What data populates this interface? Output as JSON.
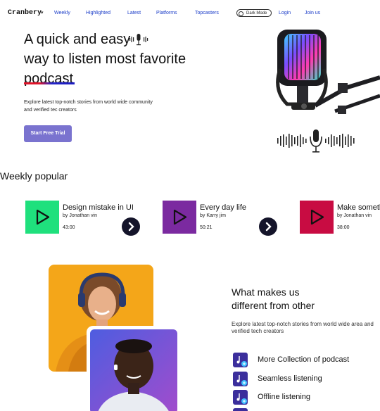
{
  "nav": {
    "brand": "Cranbery",
    "links": [
      "Weekly",
      "Highlighted",
      "Latest",
      "Platforms",
      "Topcasters"
    ],
    "dark_mode_label": "Dark Mode",
    "login": "Login",
    "join": "Join us"
  },
  "hero": {
    "title_line1": "A quick and easy",
    "title_line2": "way to listen most favorite",
    "title_line3": "podcast",
    "description": "Explore latest top-notch stories from world wide community and verified tec creators",
    "cta": "Start Free Trial"
  },
  "weekly": {
    "title": "Weekly popular",
    "cards": [
      {
        "title": "Design mistake in UI",
        "author": "by Jonathan vin",
        "duration": "43:00",
        "color": "#1fe07d"
      },
      {
        "title": "Every day life",
        "author": "by Karry jim",
        "duration": "50:21",
        "color": "#7b2aa0"
      },
      {
        "title": "Make something",
        "author": "by Jonathan vin",
        "duration": "38:00",
        "color": "#c80c42"
      }
    ]
  },
  "features": {
    "title_line1": "What makes us",
    "title_line2": "different from other",
    "description": "Explore latest top-notch stories from world wide area and verified tech creators",
    "items": [
      {
        "label": "More Collection of podcast",
        "icon": "music-note-icon"
      },
      {
        "label": "Seamless listening",
        "icon": "music-note-icon"
      },
      {
        "label": "Offline listening",
        "icon": "music-note-icon"
      }
    ]
  },
  "colors": {
    "accent": "#7a73cf",
    "link": "#1a3cc8",
    "feature_icon": "#3b2e9c"
  }
}
